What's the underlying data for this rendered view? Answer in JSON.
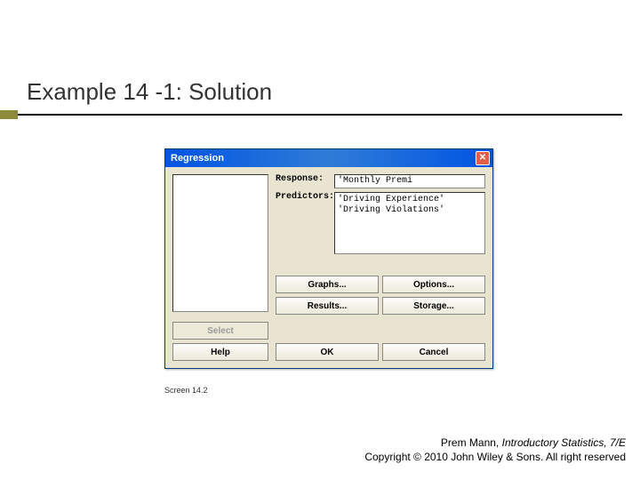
{
  "slide": {
    "title": "Example 14 -1: Solution",
    "caption": "Screen 14.2"
  },
  "dialog": {
    "title": "Regression",
    "labels": {
      "response": "Response:",
      "predictors": "Predictors:"
    },
    "fields": {
      "response_value": "'Monthly Premi",
      "predictors_value": "'Driving Experience' 'Driving Violations'"
    },
    "buttons": {
      "select": "Select",
      "help": "Help",
      "graphs": "Graphs...",
      "options": "Options...",
      "results": "Results...",
      "storage": "Storage...",
      "ok": "OK",
      "cancel": "Cancel"
    }
  },
  "footer": {
    "author": "Prem Mann, ",
    "book": "Introductory Statistics, 7/E",
    "copyright": "Copyright © 2010 John Wiley & Sons. All right reserved"
  }
}
